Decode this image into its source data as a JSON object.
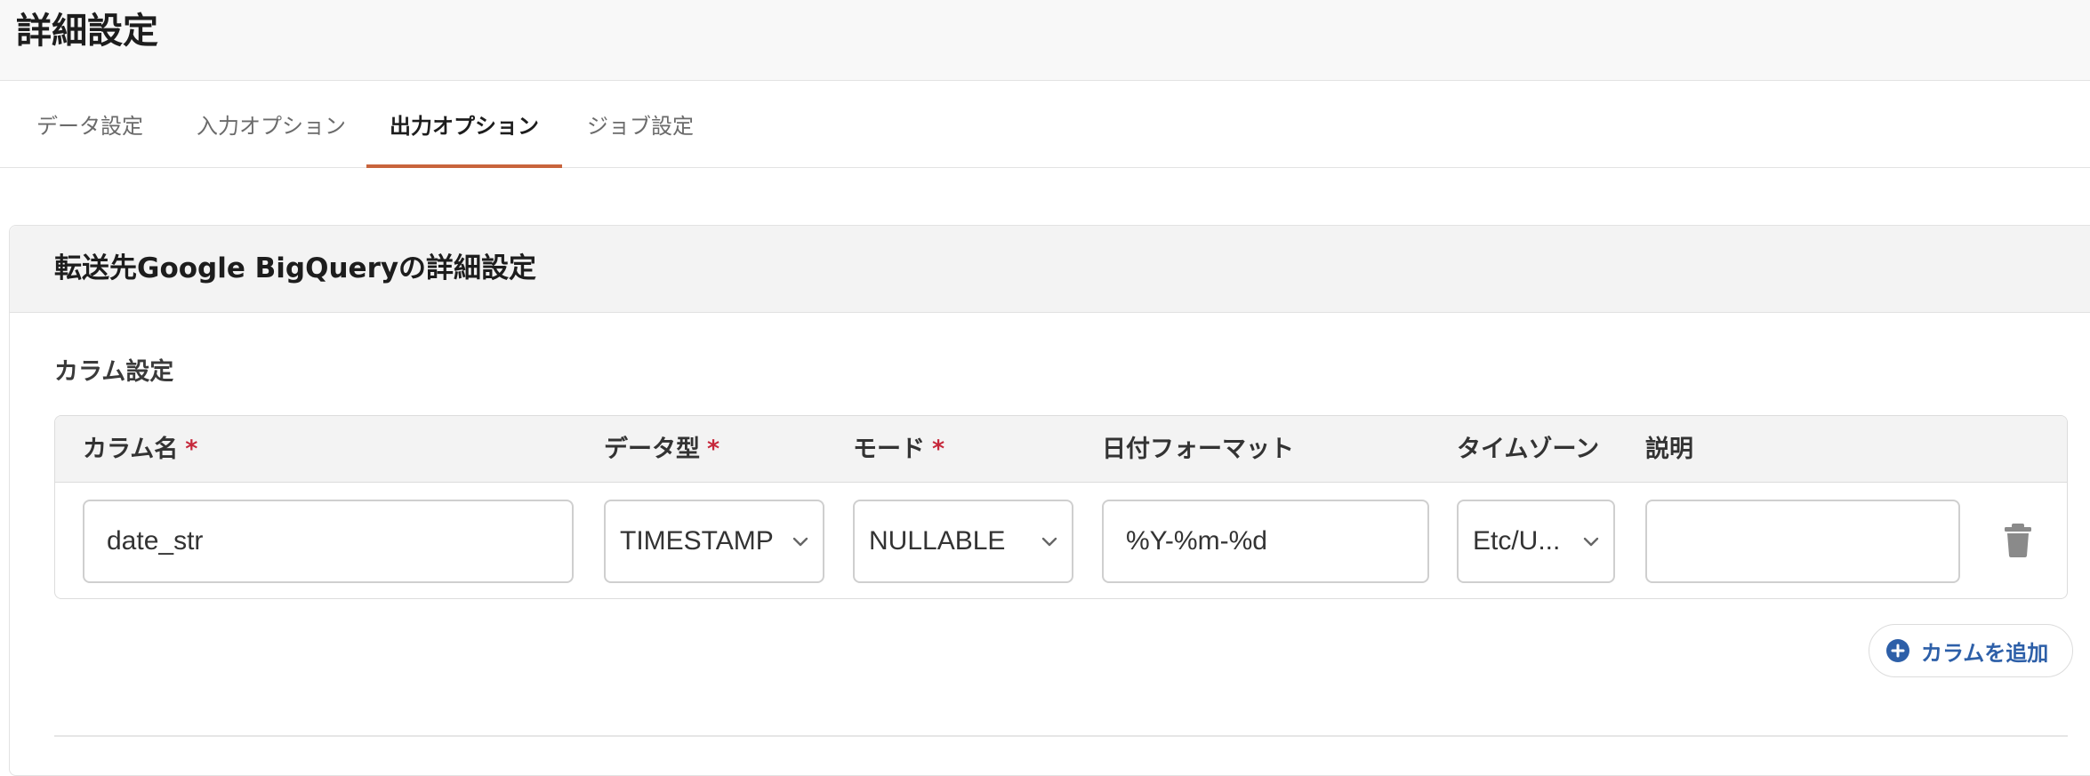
{
  "page": {
    "title": "詳細設定"
  },
  "tabs": [
    {
      "label": "データ設定",
      "active": false
    },
    {
      "label": "入力オプション",
      "active": false
    },
    {
      "label": "出力オプション",
      "active": true
    },
    {
      "label": "ジョブ設定",
      "active": false
    }
  ],
  "card": {
    "title": "転送先Google BigQueryの詳細設定",
    "section_label": "カラム設定",
    "table": {
      "headers": {
        "column_name": "カラム名",
        "data_type": "データ型",
        "mode": "モード",
        "date_format": "日付フォーマット",
        "timezone": "タイムゾーン",
        "description": "説明"
      },
      "required_marker": "*",
      "rows": [
        {
          "column_name": "date_str",
          "data_type": "TIMESTAMP",
          "mode": "NULLABLE",
          "date_format": "%Y-%m-%d",
          "timezone": "Etc/U...",
          "description": ""
        }
      ]
    },
    "add_column_label": "カラムを追加"
  },
  "icons": {
    "select_chevron": "chevron-down-icon",
    "delete": "trash-icon",
    "add": "plus-circle-icon"
  },
  "colors": {
    "accent_tab": "#c8643c",
    "required": "#c6283b",
    "link_blue": "#2d5fa8",
    "trash_gray": "#8a8a8a"
  }
}
